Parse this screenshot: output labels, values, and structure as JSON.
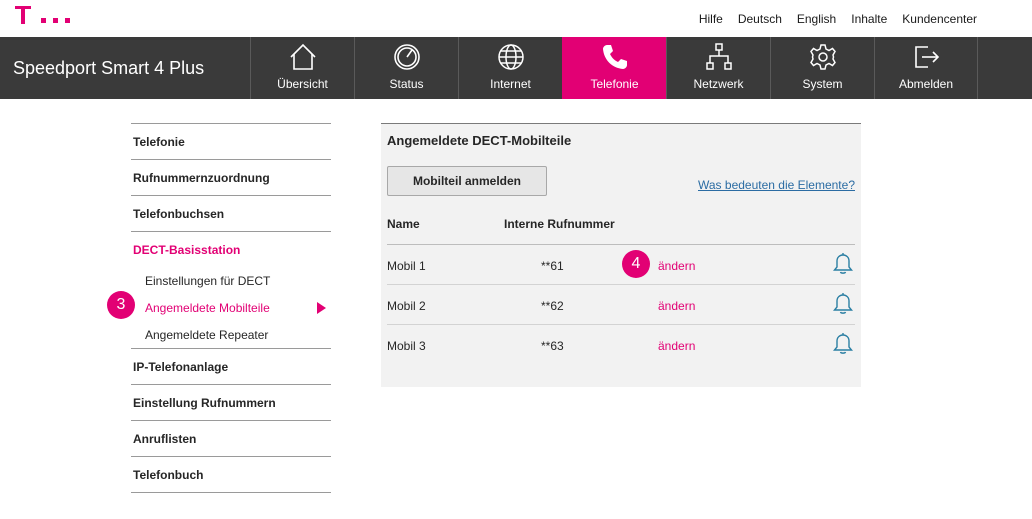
{
  "colors": {
    "brand_magenta": "#e20074",
    "nav_bg": "#3a3a3a",
    "link_blue": "#2b6ca3",
    "bell_teal": "#2b7fa3"
  },
  "header": {
    "logo_icon": "telekom-t-logo",
    "links": [
      "Hilfe",
      "Deutsch",
      "English",
      "Inhalte",
      "Kundencenter"
    ]
  },
  "nav": {
    "brand": "Speedport Smart 4 Plus",
    "tabs": [
      {
        "label": "Übersicht",
        "icon": "home-icon"
      },
      {
        "label": "Status",
        "icon": "gauge-icon"
      },
      {
        "label": "Internet",
        "icon": "globe-icon"
      },
      {
        "label": "Telefonie",
        "icon": "phone-icon",
        "active": true
      },
      {
        "label": "Netzwerk",
        "icon": "network-icon"
      },
      {
        "label": "System",
        "icon": "gear-icon"
      },
      {
        "label": "Abmelden",
        "icon": "logout-icon"
      }
    ]
  },
  "sidebar": {
    "items": [
      {
        "label": "Telefonie"
      },
      {
        "label": "Rufnummernzuordnung"
      },
      {
        "label": "Telefonbuchsen"
      },
      {
        "label": "DECT-Basisstation",
        "active": true
      },
      {
        "label": "IP-Telefonanlage"
      },
      {
        "label": "Einstellung Rufnummern"
      },
      {
        "label": "Anruflisten"
      },
      {
        "label": "Telefonbuch"
      }
    ],
    "sub_items": [
      {
        "label": "Einstellungen für DECT"
      },
      {
        "label": "Angemeldete Mobilteile",
        "active": true
      },
      {
        "label": "Angemeldete Repeater"
      }
    ],
    "callout": "3"
  },
  "main": {
    "title": "Angemeldete DECT-Mobilteile",
    "register_button": "Mobilteil anmelden",
    "help_link": "Was bedeuten die Elemente?",
    "columns": {
      "name": "Name",
      "number": "Interne Rufnummer"
    },
    "rows": [
      {
        "name": "Mobil 1",
        "number": "**61",
        "action": "ändern",
        "icon": "bell-icon"
      },
      {
        "name": "Mobil 2",
        "number": "**62",
        "action": "ändern",
        "icon": "bell-icon"
      },
      {
        "name": "Mobil 3",
        "number": "**63",
        "action": "ändern",
        "icon": "bell-icon"
      }
    ],
    "callout": "4"
  }
}
